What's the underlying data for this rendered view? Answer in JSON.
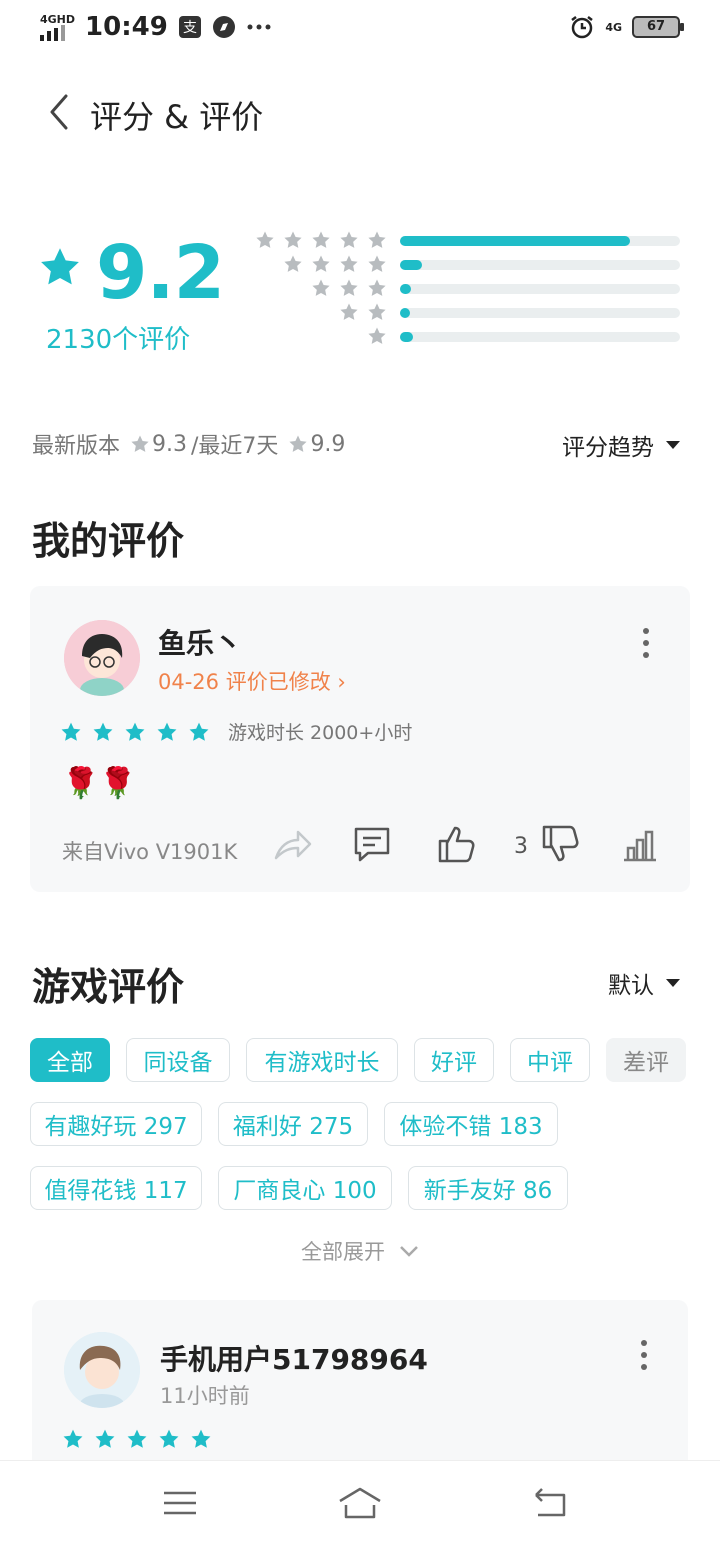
{
  "status_bar": {
    "network": "4GHD",
    "time": "10:49",
    "right_network": "4G",
    "battery": "67",
    "icons": [
      "signal-icon",
      "alipay-icon",
      "compass-icon",
      "more-dots-icon",
      "alarm-icon",
      "battery-icon"
    ]
  },
  "header": {
    "title": "评分 & 评价",
    "back_icon": "chevron-left-icon"
  },
  "rating": {
    "score": "9.2",
    "count": "2130个评价",
    "distribution": [
      {
        "stars": 5,
        "fraction": 0.82
      },
      {
        "stars": 4,
        "fraction": 0.08
      },
      {
        "stars": 3,
        "fraction": 0.04
      },
      {
        "stars": 2,
        "fraction": 0.025
      },
      {
        "stars": 1,
        "fraction": 0.045
      }
    ],
    "latest_version_label": "最新版本",
    "latest_version_score": "9.3",
    "recent_label": "/最近7天",
    "recent_score": "9.9",
    "trend_label": "评分趋势"
  },
  "my_review": {
    "section_title": "我的评价",
    "username": "鱼乐丶",
    "date_status": "04-26 评价已修改",
    "stars": 5,
    "play_time": "游戏时长 2000+小时",
    "content": "🌹🌹",
    "device": "来自Vivo V1901K",
    "likes": "3"
  },
  "game_reviews": {
    "section_title": "游戏评价",
    "sort_label": "默认",
    "tags": [
      {
        "label": "全部",
        "state": "active"
      },
      {
        "label": "同设备",
        "state": "normal"
      },
      {
        "label": "有游戏时长",
        "state": "normal"
      },
      {
        "label": "好评",
        "state": "normal"
      },
      {
        "label": "中评",
        "state": "normal"
      },
      {
        "label": "差评",
        "state": "grey"
      },
      {
        "label": "有趣好玩 297",
        "state": "normal"
      },
      {
        "label": "福利好 275",
        "state": "normal"
      },
      {
        "label": "体验不错 183",
        "state": "normal"
      },
      {
        "label": "值得花钱 117",
        "state": "normal"
      },
      {
        "label": "厂商良心 100",
        "state": "normal"
      },
      {
        "label": "新手友好 86",
        "state": "normal"
      }
    ],
    "expand_label": "全部展开",
    "first_review": {
      "username": "手机用户51798964",
      "time": "11小时前",
      "stars": 5
    }
  },
  "colors": {
    "accent": "#1fbdc8",
    "orange": "#f0824a",
    "card_bg": "#f7f8f9",
    "star_grey": "#b8bcbf"
  }
}
